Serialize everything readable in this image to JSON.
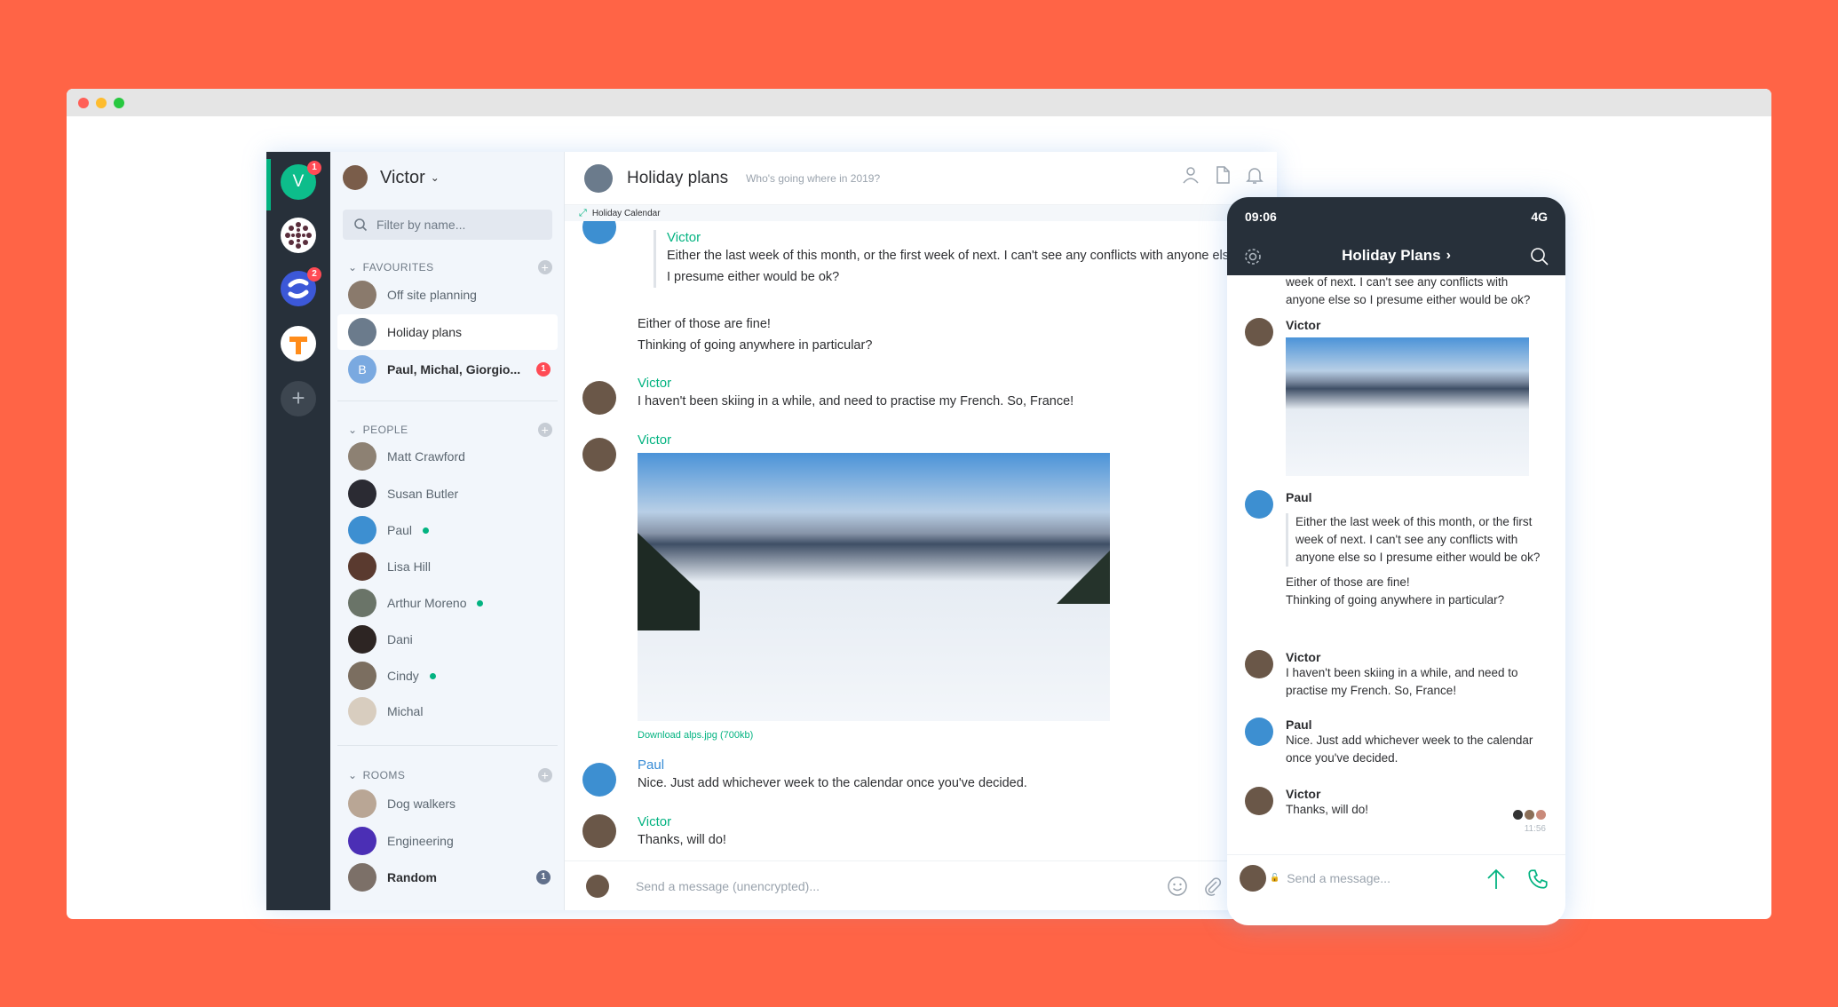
{
  "colors": {
    "background": "#ff6446",
    "accent": "#03b381",
    "sidebar": "#27303a",
    "badge": "#ff4b55"
  },
  "header_user": {
    "name": "Victor"
  },
  "rail": {
    "account_initial": "V",
    "account_badge": "1",
    "community_badge": "2"
  },
  "filter": {
    "placeholder": "Filter by name..."
  },
  "favourites": {
    "title": "FAVOURITES",
    "items": [
      {
        "label": "Off site planning"
      },
      {
        "label": "Holiday plans"
      },
      {
        "label": "Paul, Michal, Giorgio...",
        "initial": "B",
        "badge": "1"
      }
    ]
  },
  "people": {
    "title": "PEOPLE",
    "items": [
      {
        "label": "Matt Crawford"
      },
      {
        "label": "Susan Butler"
      },
      {
        "label": "Paul"
      },
      {
        "label": "Lisa Hill"
      },
      {
        "label": "Arthur Moreno"
      },
      {
        "label": "Dani"
      },
      {
        "label": "Cindy"
      },
      {
        "label": "Michal"
      }
    ]
  },
  "rooms": {
    "title": "ROOMS",
    "items": [
      {
        "label": "Dog walkers"
      },
      {
        "label": "Engineering"
      },
      {
        "label": "Random",
        "badge": "1"
      }
    ]
  },
  "room_header": {
    "title": "Holiday plans",
    "topic": "Who's going where in 2019?",
    "calendar_widget": "Holiday Calendar"
  },
  "messages": [
    {
      "sender": "Victor",
      "quote": "Either the last week of this month, or the first week of next. I can't see any conflicts with anyone else so I presume either would be ok?"
    },
    {
      "line1": "Either of those are fine!",
      "line2": "Thinking of going anywhere in particular?"
    },
    {
      "sender": "Victor",
      "text": "I haven't been skiing in a while, and need to practise my French. So, France!"
    },
    {
      "sender": "Victor",
      "download": "Download alps.jpg (700kb)"
    },
    {
      "sender": "Paul",
      "text": "Nice. Just add whichever week to the calendar once you've decided."
    },
    {
      "sender": "Victor",
      "text": "Thanks, will do!"
    }
  ],
  "composer": {
    "placeholder": "Send a message (unencrypted)..."
  },
  "phone": {
    "time": "09:06",
    "network": "4G",
    "title": "Holiday Plans",
    "top_text": "week of next. I can't see any conflicts with anyone else so I presume either would be ok?",
    "msgs": [
      {
        "sender": "Victor"
      },
      {
        "sender": "Paul",
        "quote": "Either the last week of this month, or the first week of next. I can't see any conflicts with anyone else so I presume either would be ok?",
        "line1": "Either of those are fine!",
        "line2": "Thinking of going anywhere in particular?"
      },
      {
        "sender": "Victor",
        "text": "I haven't been skiing in a while, and need to practise my French. So, France!"
      },
      {
        "sender": "Paul",
        "text": "Nice. Just add whichever week to the calendar once you've decided."
      },
      {
        "sender": "Victor",
        "text": "Thanks, will do!",
        "time": "11:56"
      }
    ],
    "composer_placeholder": "Send a message..."
  }
}
